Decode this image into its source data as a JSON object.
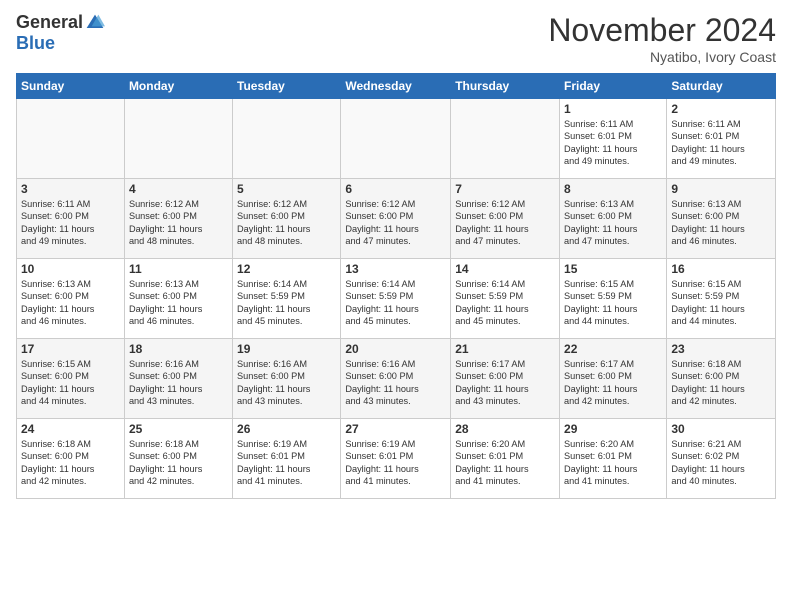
{
  "logo": {
    "general": "General",
    "blue": "Blue"
  },
  "header": {
    "month": "November 2024",
    "location": "Nyatibo, Ivory Coast"
  },
  "days_of_week": [
    "Sunday",
    "Monday",
    "Tuesday",
    "Wednesday",
    "Thursday",
    "Friday",
    "Saturday"
  ],
  "weeks": [
    [
      {
        "day": "",
        "info": ""
      },
      {
        "day": "",
        "info": ""
      },
      {
        "day": "",
        "info": ""
      },
      {
        "day": "",
        "info": ""
      },
      {
        "day": "",
        "info": ""
      },
      {
        "day": "1",
        "info": "Sunrise: 6:11 AM\nSunset: 6:01 PM\nDaylight: 11 hours\nand 49 minutes."
      },
      {
        "day": "2",
        "info": "Sunrise: 6:11 AM\nSunset: 6:01 PM\nDaylight: 11 hours\nand 49 minutes."
      }
    ],
    [
      {
        "day": "3",
        "info": "Sunrise: 6:11 AM\nSunset: 6:00 PM\nDaylight: 11 hours\nand 49 minutes."
      },
      {
        "day": "4",
        "info": "Sunrise: 6:12 AM\nSunset: 6:00 PM\nDaylight: 11 hours\nand 48 minutes."
      },
      {
        "day": "5",
        "info": "Sunrise: 6:12 AM\nSunset: 6:00 PM\nDaylight: 11 hours\nand 48 minutes."
      },
      {
        "day": "6",
        "info": "Sunrise: 6:12 AM\nSunset: 6:00 PM\nDaylight: 11 hours\nand 47 minutes."
      },
      {
        "day": "7",
        "info": "Sunrise: 6:12 AM\nSunset: 6:00 PM\nDaylight: 11 hours\nand 47 minutes."
      },
      {
        "day": "8",
        "info": "Sunrise: 6:13 AM\nSunset: 6:00 PM\nDaylight: 11 hours\nand 47 minutes."
      },
      {
        "day": "9",
        "info": "Sunrise: 6:13 AM\nSunset: 6:00 PM\nDaylight: 11 hours\nand 46 minutes."
      }
    ],
    [
      {
        "day": "10",
        "info": "Sunrise: 6:13 AM\nSunset: 6:00 PM\nDaylight: 11 hours\nand 46 minutes."
      },
      {
        "day": "11",
        "info": "Sunrise: 6:13 AM\nSunset: 6:00 PM\nDaylight: 11 hours\nand 46 minutes."
      },
      {
        "day": "12",
        "info": "Sunrise: 6:14 AM\nSunset: 5:59 PM\nDaylight: 11 hours\nand 45 minutes."
      },
      {
        "day": "13",
        "info": "Sunrise: 6:14 AM\nSunset: 5:59 PM\nDaylight: 11 hours\nand 45 minutes."
      },
      {
        "day": "14",
        "info": "Sunrise: 6:14 AM\nSunset: 5:59 PM\nDaylight: 11 hours\nand 45 minutes."
      },
      {
        "day": "15",
        "info": "Sunrise: 6:15 AM\nSunset: 5:59 PM\nDaylight: 11 hours\nand 44 minutes."
      },
      {
        "day": "16",
        "info": "Sunrise: 6:15 AM\nSunset: 5:59 PM\nDaylight: 11 hours\nand 44 minutes."
      }
    ],
    [
      {
        "day": "17",
        "info": "Sunrise: 6:15 AM\nSunset: 6:00 PM\nDaylight: 11 hours\nand 44 minutes."
      },
      {
        "day": "18",
        "info": "Sunrise: 6:16 AM\nSunset: 6:00 PM\nDaylight: 11 hours\nand 43 minutes."
      },
      {
        "day": "19",
        "info": "Sunrise: 6:16 AM\nSunset: 6:00 PM\nDaylight: 11 hours\nand 43 minutes."
      },
      {
        "day": "20",
        "info": "Sunrise: 6:16 AM\nSunset: 6:00 PM\nDaylight: 11 hours\nand 43 minutes."
      },
      {
        "day": "21",
        "info": "Sunrise: 6:17 AM\nSunset: 6:00 PM\nDaylight: 11 hours\nand 43 minutes."
      },
      {
        "day": "22",
        "info": "Sunrise: 6:17 AM\nSunset: 6:00 PM\nDaylight: 11 hours\nand 42 minutes."
      },
      {
        "day": "23",
        "info": "Sunrise: 6:18 AM\nSunset: 6:00 PM\nDaylight: 11 hours\nand 42 minutes."
      }
    ],
    [
      {
        "day": "24",
        "info": "Sunrise: 6:18 AM\nSunset: 6:00 PM\nDaylight: 11 hours\nand 42 minutes."
      },
      {
        "day": "25",
        "info": "Sunrise: 6:18 AM\nSunset: 6:00 PM\nDaylight: 11 hours\nand 42 minutes."
      },
      {
        "day": "26",
        "info": "Sunrise: 6:19 AM\nSunset: 6:01 PM\nDaylight: 11 hours\nand 41 minutes."
      },
      {
        "day": "27",
        "info": "Sunrise: 6:19 AM\nSunset: 6:01 PM\nDaylight: 11 hours\nand 41 minutes."
      },
      {
        "day": "28",
        "info": "Sunrise: 6:20 AM\nSunset: 6:01 PM\nDaylight: 11 hours\nand 41 minutes."
      },
      {
        "day": "29",
        "info": "Sunrise: 6:20 AM\nSunset: 6:01 PM\nDaylight: 11 hours\nand 41 minutes."
      },
      {
        "day": "30",
        "info": "Sunrise: 6:21 AM\nSunset: 6:02 PM\nDaylight: 11 hours\nand 40 minutes."
      }
    ]
  ]
}
